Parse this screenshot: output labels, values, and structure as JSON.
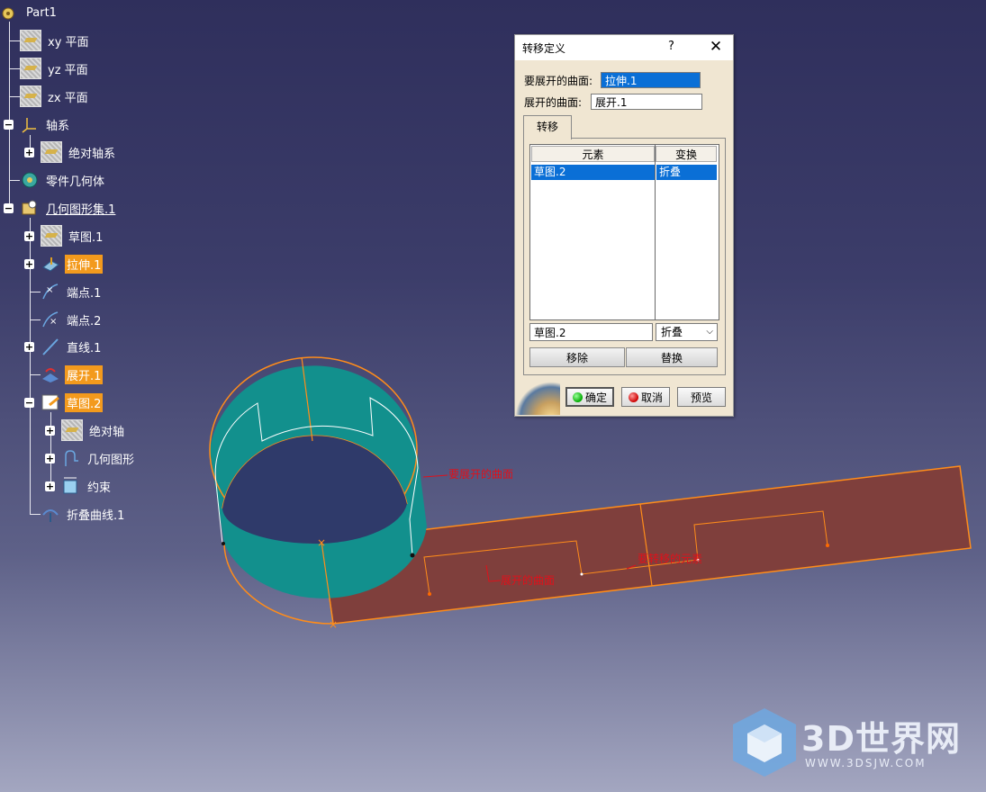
{
  "colors": {
    "background_top": "#2f2f5c",
    "background_bottom": "#a3a6c0",
    "highlight": "#f39a1d",
    "cylinder": "#14908e",
    "unfold_surface": "#7f3f3c",
    "edge": "#ff8c1a",
    "annotation": "#e0101a",
    "selection": "#0a6fd6"
  },
  "tree": {
    "root": "Part1",
    "xy_plane": "xy 平面",
    "yz_plane": "yz 平面",
    "zx_plane": "zx 平面",
    "axis_system": "轴系",
    "absolute_axis": "绝对轴系",
    "part_body": "零件几何体",
    "geo_set": "几何图形集.1",
    "sketch1": "草图.1",
    "extrude1": "拉伸.1",
    "endpoint1": "端点.1",
    "endpoint2": "端点.2",
    "line1": "直线.1",
    "unfold1": "展开.1",
    "sketch2": "草图.2",
    "abs_axis": "绝对轴",
    "geometry": "几何图形",
    "constraints": "约束",
    "fold_curve": "折叠曲线.1"
  },
  "dialog": {
    "title": "转移定义",
    "help": "?",
    "close": "✕",
    "surface_to_unfold_label": "要展开的曲面:",
    "surface_to_unfold_value": "拉伸.1",
    "unfolded_surface_label": "展开的曲面:",
    "unfolded_surface_value": "展开.1",
    "tab_transfer": "转移",
    "col_element": "元素",
    "col_transform": "变换",
    "row_element": "草图.2",
    "row_transform": "折叠",
    "edit_element": "草图.2",
    "transform_select": "折叠",
    "remove_button": "移除",
    "replace_button": "替换",
    "ok_button": "确定",
    "cancel_button": "取消",
    "preview_button": "预览"
  },
  "annotations": {
    "surface_to_unfold": "要展开的曲面",
    "unfolded_surface": "展开的曲面",
    "elements_to_transfer": "要转移的元素"
  },
  "watermark": {
    "text": "3D世界网",
    "url": "WWW.3DSJW.COM"
  }
}
